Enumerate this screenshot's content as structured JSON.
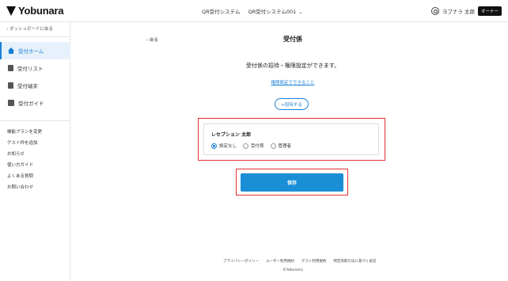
{
  "header": {
    "logo_text": "Yobunara",
    "nav": {
      "item1": "QR受付システム",
      "item2": "QR受付システム001"
    },
    "user": {
      "name": "ヨブナラ 太郎",
      "badge": "オーナー"
    }
  },
  "sidebar": {
    "back_label": "ダッシュボードに戻る",
    "items": [
      {
        "label": "受付ホーム",
        "icon": "home-icon",
        "active": true
      },
      {
        "label": "受付リスト",
        "icon": "list-icon",
        "active": false
      },
      {
        "label": "受付端末",
        "icon": "terminal-icon",
        "active": false
      },
      {
        "label": "受付ガイド",
        "icon": "guide-icon",
        "active": false
      }
    ],
    "links": [
      "機能プランを変更",
      "ゲスト枠を追加",
      "お知らせ",
      "使い方ガイド",
      "よくある質問",
      "お問い合わせ"
    ]
  },
  "main": {
    "back_label": "戻る",
    "title": "受付係",
    "description": "受付係の招待・権限設定ができます。",
    "permission_link": "権限設定でできること",
    "invite_label": "+招待する",
    "member": {
      "name": "レセプション 太郎",
      "options": [
        {
          "label": "設定なし",
          "selected": true
        },
        {
          "label": "受付係",
          "selected": false
        },
        {
          "label": "管理者",
          "selected": false
        }
      ]
    },
    "save_label": "保存"
  },
  "footer": {
    "links": [
      "プライバシーポリシー",
      "ユーザー利用規約",
      "ゲスト利用規約",
      "特定商取引法に基づく表記"
    ],
    "copyright": "©Yobunara"
  },
  "colors": {
    "accent": "#1a8fd6",
    "highlight": "#e03030"
  }
}
